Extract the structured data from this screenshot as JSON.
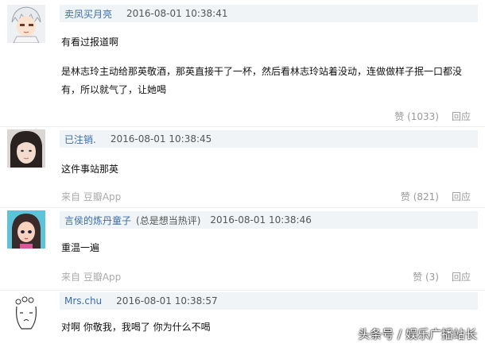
{
  "comments": [
    {
      "author": "卖凤买月亮",
      "author_note": "",
      "time": "2016-08-01 10:38:41",
      "lines": [
        "有看过报道啊",
        "是林志玲主动给那英敬酒，那英直接干了一杯，然后看林志玲站着没动，连做做样子抿一口都没有，所以就气了，让她喝"
      ],
      "source": "",
      "like": "赞 (1033)",
      "reply": "回应"
    },
    {
      "author": "已注销.",
      "author_note": "",
      "time": "2016-08-01 10:38:45",
      "lines": [
        "这件事站那英"
      ],
      "source": "来自 豆瓣App",
      "like": "赞 (821)",
      "reply": "回应"
    },
    {
      "author": "言侯的炼丹童子",
      "author_note": "(总是想当热评)",
      "time": "2016-08-01 10:38:46",
      "lines": [
        "重温一遍"
      ],
      "source": "来自 豆瓣App",
      "like": "赞 (3)",
      "reply": "回应"
    },
    {
      "author": "Mrs.chu",
      "author_note": "",
      "time": "2016-08-01 10:38:57",
      "lines": [
        "对啊 你敬我，我喝了 你为什么不喝"
      ],
      "source": "",
      "like": "",
      "reply": ""
    }
  ],
  "watermark": "头条号 / 娱乐广播站长",
  "icons": {
    "avatar_1": "anime-boy-avatar",
    "avatar_2": "girl-photo-avatar",
    "avatar_3": "cartoon-girl-avatar",
    "avatar_4": "doodle-face-avatar"
  }
}
